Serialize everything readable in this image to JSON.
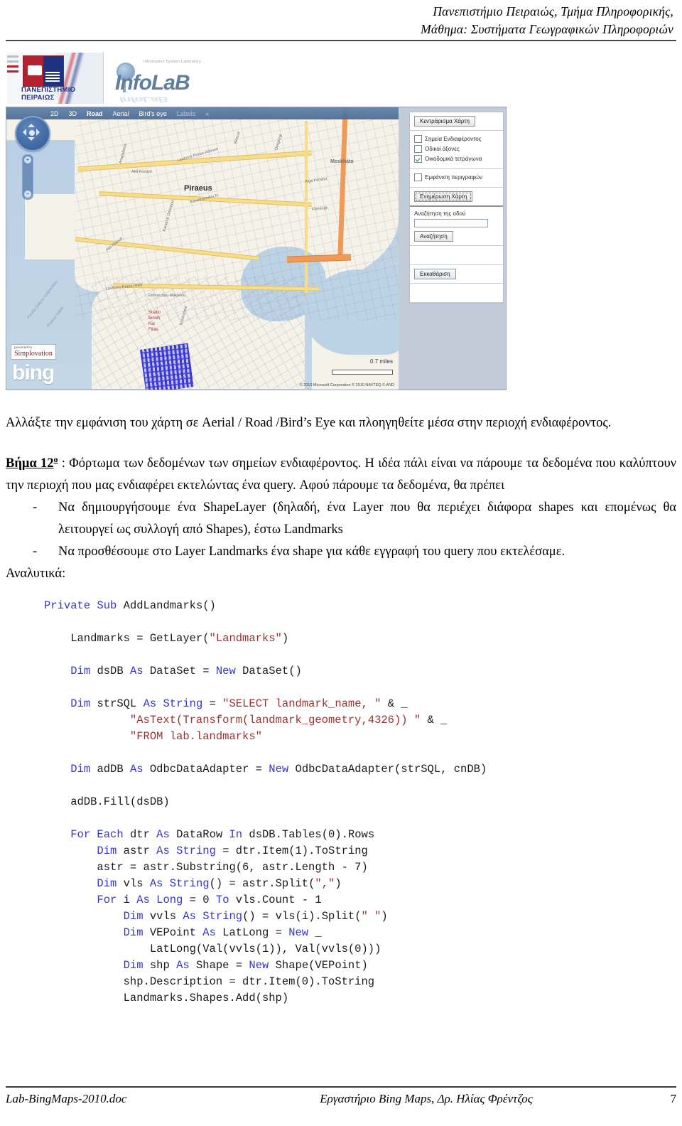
{
  "header": {
    "line1": "Πανεπιστήμιο Πειραιώς, Τμήμα Πληροφορικής,",
    "line2": "Μάθημα: Συστήματα Γεωγραφικών Πληροφοριών"
  },
  "figure": {
    "banner": {
      "university_name_line1": "ΠΑΝΕΠΙΣΤΗΜΙΟ",
      "university_name_line2": "ΠΕΙΡΑΙΩΣ",
      "infolab_tagline": "Information System Laboratory",
      "infolab_name": "InfoLaB"
    },
    "map": {
      "toolbar": [
        "2D",
        "3D",
        "Road",
        "Aerial",
        "Bird's eye",
        "Labels",
        "«"
      ],
      "labels": {
        "city": "Piraeus",
        "moskhato": "Moskháto",
        "stadio1": "Stadio",
        "stadio2": "Eirinis",
        "stadio3": "Kai",
        "stadio4": "Filias",
        "leoforos": "Leoforos Petrou Ralli",
        "leoforos2": "Leoforos Pireos-Athinon",
        "eth_makariou": "Ethnarchou Makariou",
        "odos_a": "Akti Kondyli",
        "odos_b": "Akti Miaouli",
        "odos_c": "Kanellopoulou N",
        "odos_d": "Riga Feraiou",
        "odos_e": "Flemingk",
        "odos_f": "Skouze",
        "odos_g": "Kanari & Omiridou",
        "odos_h": "Kolokotroni",
        "odos_i": "Deligiorgi",
        "odos_j": "Anapafseos",
        "odos_k": "Piraeus Italian",
        "odos_l": "Paralia Odigou Kolymvitirio"
      },
      "scale_text": "0.7 miles",
      "copyright": "© 2010 Microsoft Corporation   © 2010 NAVTEQ   © AND",
      "powered_by_label": "powered by",
      "powered_by_name": "Simplovation",
      "bing_logo": "bing"
    },
    "control_panel": {
      "center_map_button": "Κεντράρισμα Χάρτη",
      "layers": [
        {
          "label": "Σημεία Ενδιαφέροντος",
          "checked": false
        },
        {
          "label": "Οδικοί άξονες",
          "checked": false
        },
        {
          "label": "Οικοδομικά τετράγωνα",
          "checked": true
        }
      ],
      "show_descriptions": {
        "label": "Εμφάνιση περιγραφών",
        "checked": false
      },
      "update_map_button": "Ενημέρωση Χάρτη",
      "street_search_label": "Αναζήτηση της οδού",
      "street_search_value": "",
      "search_button": "Αναζήτηση",
      "clear_button": "Εκκαθάριση"
    }
  },
  "body": {
    "p1": "Αλλάξτε την εμφάνιση του χάρτη σε Aerial / Road /Bird’s Eye και πλοηγηθείτε μέσα στην περιοχή ενδιαφέροντος.",
    "step_label": "Βήμα 12",
    "step_sup": "ο",
    "step_text": " : Φόρτωμα των δεδομένων των σημείων ενδιαφέροντος. Η ιδέα πάλι είναι να πάρουμε τα δεδομένα που καλύπτουν την περιοχή που μας ενδιαφέρει εκτελώντας ένα query. Αφού πάρουμε τα δεδομένα, θα πρέπει",
    "bullet1": "Να δημιουργήσουμε ένα ShapeLayer (δηλαδή, ένα Layer που θα περιέχει διάφορα shapes και επομένως θα λειτουργεί ως συλλογή από Shapes), έστω Landmarks",
    "bullet2": "Να προσθέσουμε στο Layer Landmarks ένα shape για κάθε εγγραφή του query που εκτελέσαμε.",
    "analytic": "Αναλυτικά:"
  },
  "code": {
    "lines": [
      [
        {
          "t": "Private ",
          "c": "kw"
        },
        {
          "t": "Sub ",
          "c": "kw"
        },
        {
          "t": "AddLandmarks()",
          "c": ""
        }
      ],
      [
        {
          "t": "",
          "c": ""
        }
      ],
      [
        {
          "t": "    Landmarks = GetLayer(",
          "c": ""
        },
        {
          "t": "\"Landmarks\"",
          "c": "str"
        },
        {
          "t": ")",
          "c": ""
        }
      ],
      [
        {
          "t": "",
          "c": ""
        }
      ],
      [
        {
          "t": "    ",
          "c": ""
        },
        {
          "t": "Dim ",
          "c": "kw"
        },
        {
          "t": "dsDB ",
          "c": ""
        },
        {
          "t": "As ",
          "c": "kw"
        },
        {
          "t": "DataSet = ",
          "c": ""
        },
        {
          "t": "New ",
          "c": "kw"
        },
        {
          "t": "DataSet()",
          "c": ""
        }
      ],
      [
        {
          "t": "",
          "c": ""
        }
      ],
      [
        {
          "t": "    ",
          "c": ""
        },
        {
          "t": "Dim ",
          "c": "kw"
        },
        {
          "t": "strSQL ",
          "c": ""
        },
        {
          "t": "As ",
          "c": "kw"
        },
        {
          "t": "String ",
          "c": "kw"
        },
        {
          "t": "= ",
          "c": ""
        },
        {
          "t": "\"SELECT landmark_name, \"",
          "c": "str"
        },
        {
          "t": " & _",
          "c": ""
        }
      ],
      [
        {
          "t": "             ",
          "c": ""
        },
        {
          "t": "\"AsText(Transform(landmark_geometry,4326)) \"",
          "c": "str"
        },
        {
          "t": " & _",
          "c": ""
        }
      ],
      [
        {
          "t": "             ",
          "c": ""
        },
        {
          "t": "\"FROM lab.landmarks\"",
          "c": "str"
        }
      ],
      [
        {
          "t": "",
          "c": ""
        }
      ],
      [
        {
          "t": "    ",
          "c": ""
        },
        {
          "t": "Dim ",
          "c": "kw"
        },
        {
          "t": "adDB ",
          "c": ""
        },
        {
          "t": "As ",
          "c": "kw"
        },
        {
          "t": "OdbcDataAdapter = ",
          "c": ""
        },
        {
          "t": "New ",
          "c": "kw"
        },
        {
          "t": "OdbcDataAdapter(strSQL, cnDB)",
          "c": ""
        }
      ],
      [
        {
          "t": "",
          "c": ""
        }
      ],
      [
        {
          "t": "    adDB.Fill(dsDB)",
          "c": ""
        }
      ],
      [
        {
          "t": "",
          "c": ""
        }
      ],
      [
        {
          "t": "    ",
          "c": ""
        },
        {
          "t": "For Each ",
          "c": "kw"
        },
        {
          "t": "dtr ",
          "c": ""
        },
        {
          "t": "As ",
          "c": "kw"
        },
        {
          "t": "DataRow ",
          "c": ""
        },
        {
          "t": "In ",
          "c": "kw"
        },
        {
          "t": "dsDB.Tables(0).Rows",
          "c": ""
        }
      ],
      [
        {
          "t": "        ",
          "c": ""
        },
        {
          "t": "Dim ",
          "c": "kw"
        },
        {
          "t": "astr ",
          "c": ""
        },
        {
          "t": "As ",
          "c": "kw"
        },
        {
          "t": "String ",
          "c": "kw"
        },
        {
          "t": "= dtr.Item(1).ToString",
          "c": ""
        }
      ],
      [
        {
          "t": "        astr = astr.Substring(6, astr.Length - 7)",
          "c": ""
        }
      ],
      [
        {
          "t": "        ",
          "c": ""
        },
        {
          "t": "Dim ",
          "c": "kw"
        },
        {
          "t": "vls ",
          "c": ""
        },
        {
          "t": "As ",
          "c": "kw"
        },
        {
          "t": "String",
          "c": "kw"
        },
        {
          "t": "() = astr.Split(",
          "c": ""
        },
        {
          "t": "\",\"",
          "c": "str"
        },
        {
          "t": ")",
          "c": ""
        }
      ],
      [
        {
          "t": "        ",
          "c": ""
        },
        {
          "t": "For ",
          "c": "kw"
        },
        {
          "t": "i ",
          "c": ""
        },
        {
          "t": "As ",
          "c": "kw"
        },
        {
          "t": "Long ",
          "c": "kw"
        },
        {
          "t": "= 0 ",
          "c": ""
        },
        {
          "t": "To ",
          "c": "kw"
        },
        {
          "t": "vls.Count - 1",
          "c": ""
        }
      ],
      [
        {
          "t": "            ",
          "c": ""
        },
        {
          "t": "Dim ",
          "c": "kw"
        },
        {
          "t": "vvls ",
          "c": ""
        },
        {
          "t": "As ",
          "c": "kw"
        },
        {
          "t": "String",
          "c": "kw"
        },
        {
          "t": "() = vls(i).Split(",
          "c": ""
        },
        {
          "t": "\" \"",
          "c": "str"
        },
        {
          "t": ")",
          "c": ""
        }
      ],
      [
        {
          "t": "            ",
          "c": ""
        },
        {
          "t": "Dim ",
          "c": "kw"
        },
        {
          "t": "VEPoint ",
          "c": ""
        },
        {
          "t": "As ",
          "c": "kw"
        },
        {
          "t": "LatLong = ",
          "c": ""
        },
        {
          "t": "New ",
          "c": "kw"
        },
        {
          "t": "_",
          "c": ""
        }
      ],
      [
        {
          "t": "                LatLong(Val(vvls(1)), Val(vvls(0)))",
          "c": ""
        }
      ],
      [
        {
          "t": "            ",
          "c": ""
        },
        {
          "t": "Dim ",
          "c": "kw"
        },
        {
          "t": "shp ",
          "c": ""
        },
        {
          "t": "As ",
          "c": "kw"
        },
        {
          "t": "Shape = ",
          "c": ""
        },
        {
          "t": "New ",
          "c": "kw"
        },
        {
          "t": "Shape(VEPoint)",
          "c": ""
        }
      ],
      [
        {
          "t": "            shp.Description = dtr.Item(0).ToString",
          "c": ""
        }
      ],
      [
        {
          "t": "            Landmarks.Shapes.Add(shp)",
          "c": ""
        }
      ]
    ]
  },
  "footer": {
    "left": "Lab-BingMaps-2010.doc",
    "middle": "Εργαστήριο Bing Maps, Δρ. Ηλίας Φρέντζος",
    "page": "7"
  }
}
